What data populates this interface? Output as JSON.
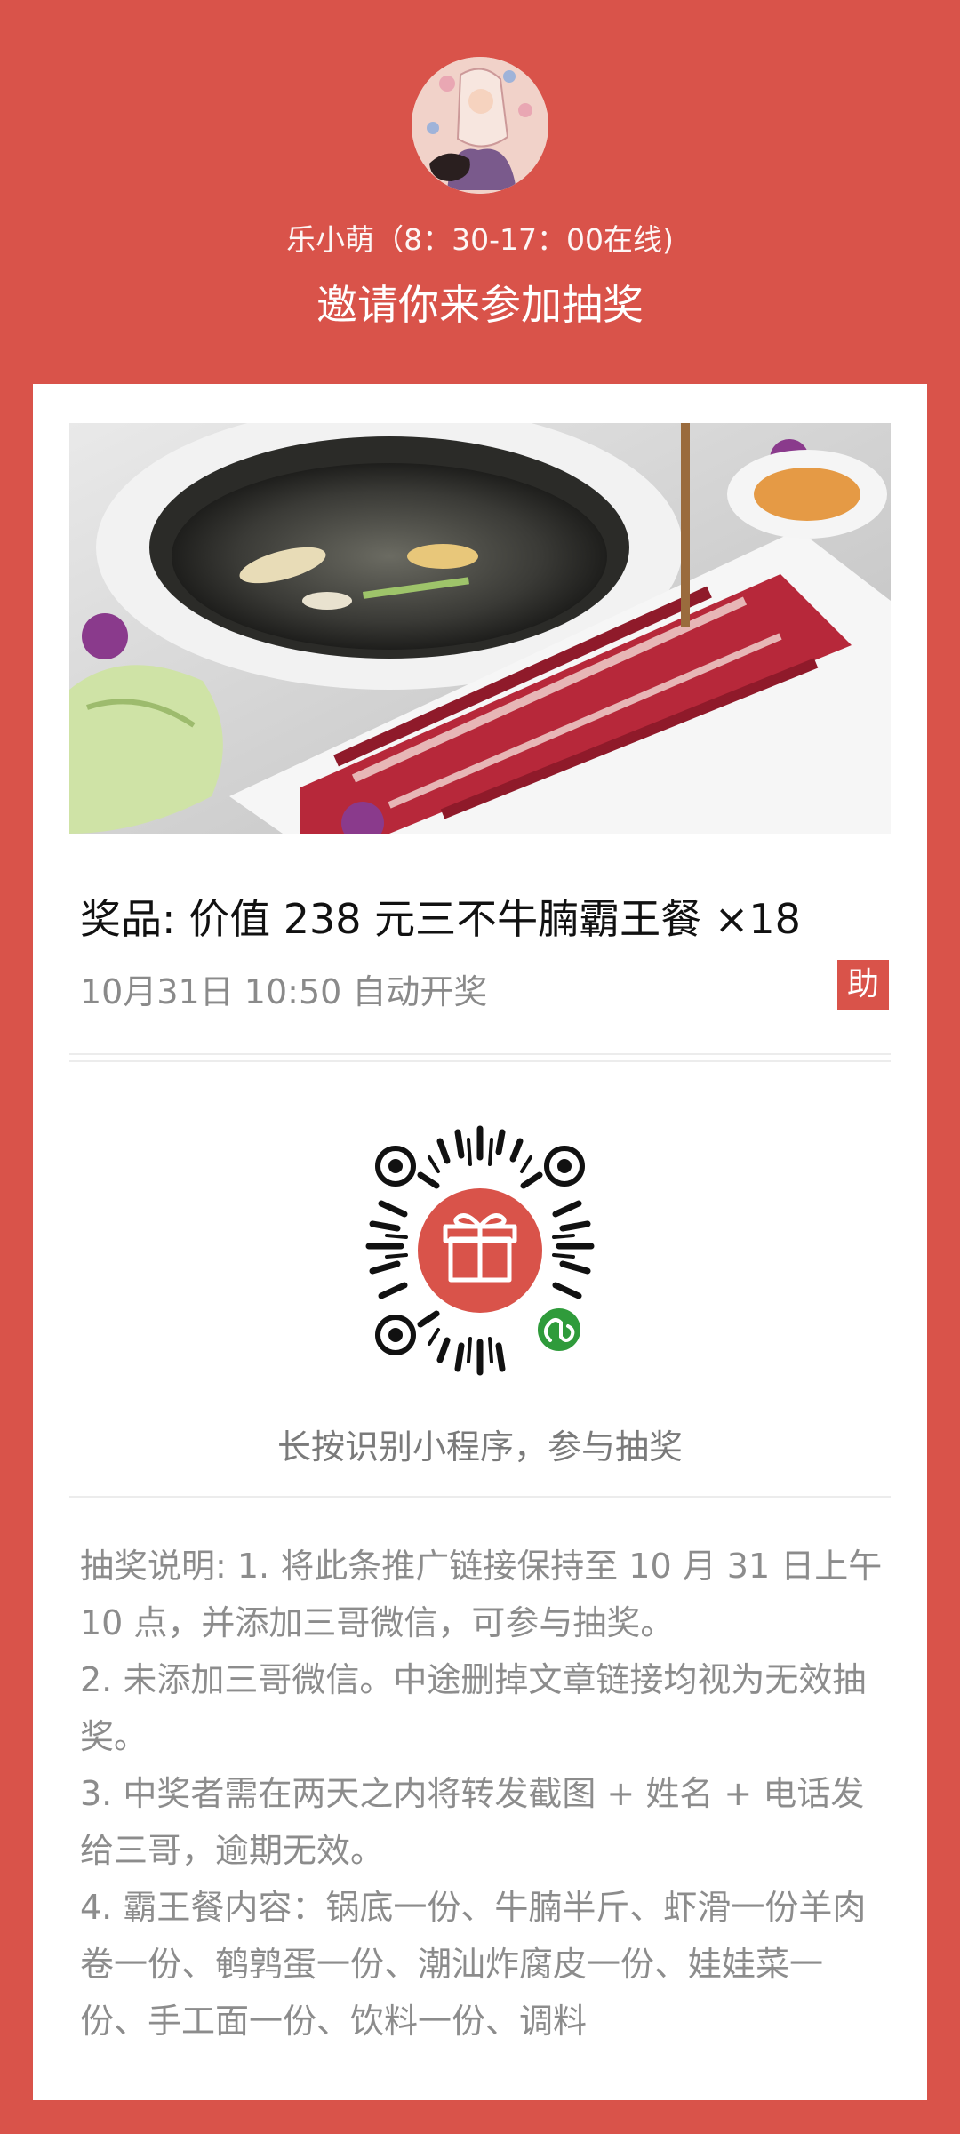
{
  "header": {
    "host_name": "乐小萌（8：30-17：00在线)",
    "invite_text": "邀请你来参加抽奖"
  },
  "prize": {
    "title": "奖品: 价值 238 元三不牛腩霸王餐 ×18",
    "draw_time": "10月31日 10:50 自动开奖",
    "badge": "助"
  },
  "qr": {
    "hint": "长按识别小程序，参与抽奖",
    "center_icon": "gift-icon",
    "corner_icon": "mini-program-icon"
  },
  "rules": [
    "抽奖说明: 1. 将此条推广链接保持至 10 月 31 日上午 10 点，并添加三哥微信，可参与抽奖。",
    "2. 未添加三哥微信。中途删掉文章链接均视为无效抽奖。",
    "3. 中奖者需在两天之内将转发截图 + 姓名 + 电话发给三哥，逾期无效。",
    "4. 霸王餐内容：锅底一份、牛腩半斤、虾滑一份羊肉卷一份、鹌鹑蛋一份、潮汕炸腐皮一份、娃娃菜一份、手工面一份、饮料一份、调料"
  ],
  "colors": {
    "brand_red": "#d9534a",
    "card_bg": "#ffffff",
    "muted_text": "#8a8a8a"
  }
}
